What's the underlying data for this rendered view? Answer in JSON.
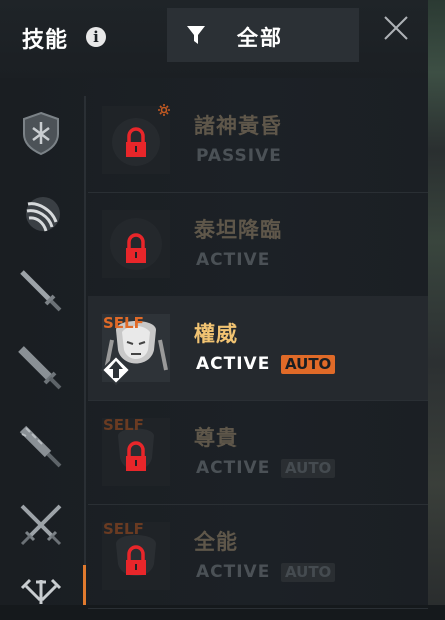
{
  "header": {
    "title": "技能",
    "info_icon": "info-icon",
    "filter_label": "全部",
    "filter_icon": "funnel-icon",
    "close_icon": "close-icon"
  },
  "sidebar": {
    "items": [
      {
        "icon": "shield-icon"
      },
      {
        "icon": "claw-slash-icon"
      },
      {
        "icon": "sword-icon"
      },
      {
        "icon": "greatsword-icon"
      },
      {
        "icon": "spiked-club-icon"
      },
      {
        "icon": "crossed-swords-icon"
      },
      {
        "icon": "multi-weapon-icon"
      }
    ]
  },
  "skills": [
    {
      "name": "諸神黃昏",
      "type": "PASSIVE",
      "self": "",
      "auto": "",
      "locked": true,
      "selected": false
    },
    {
      "name": "泰坦降臨",
      "type": "ACTIVE",
      "self": "",
      "auto": "",
      "locked": true,
      "selected": false
    },
    {
      "name": "權威",
      "type": "ACTIVE",
      "self": "SELF",
      "auto": "AUTO",
      "locked": false,
      "selected": true
    },
    {
      "name": "尊貴",
      "type": "ACTIVE",
      "self": "SELF",
      "auto": "AUTO",
      "locked": true,
      "selected": false
    },
    {
      "name": "全能",
      "type": "ACTIVE",
      "self": "SELF",
      "auto": "AUTO",
      "locked": true,
      "selected": false
    }
  ],
  "colors": {
    "accent_orange": "#e06a28",
    "name_active": "#f1c372",
    "lock_red": "#e8262a"
  }
}
